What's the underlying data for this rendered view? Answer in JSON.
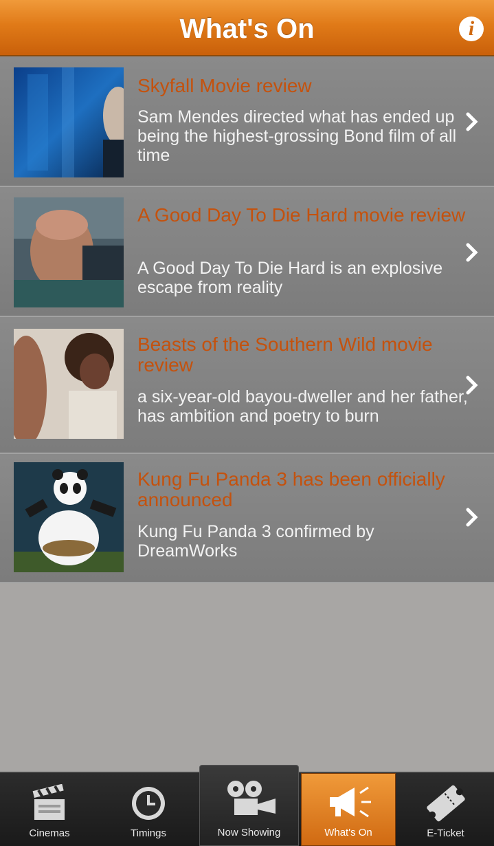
{
  "header": {
    "title": "What's On",
    "info_icon": "info-icon",
    "info_label": "i",
    "color": "#e07a18"
  },
  "articles": [
    {
      "title": "Skyfall Movie review",
      "description": "Sam Mendes directed what has ended up being the highest-grossing Bond film of all time",
      "thumbnail": "skyfall-still"
    },
    {
      "title": "A Good Day To Die Hard movie review",
      "description": "A Good Day To Die Hard is an explosive escape from reality",
      "thumbnail": "die-hard-still"
    },
    {
      "title": "Beasts of the Southern Wild movie review",
      "description": "a six-year-old bayou-dweller and her father, has ambition and poetry to burn",
      "thumbnail": "beasts-still"
    },
    {
      "title": "Kung Fu Panda 3 has been officially announced",
      "description": "Kung Fu Panda 3  confirmed by DreamWorks",
      "thumbnail": "panda-still"
    }
  ],
  "tabs": [
    {
      "label": "Cinemas",
      "icon": "clapperboard-icon"
    },
    {
      "label": "Timings",
      "icon": "clock-icon"
    },
    {
      "label": "Now Showing",
      "icon": "projector-icon"
    },
    {
      "label": "What's On",
      "icon": "megaphone-icon",
      "active": true
    },
    {
      "label": "E-Ticket",
      "icon": "ticket-icon"
    }
  ],
  "colors": {
    "accent": "#e07a18",
    "title_text": "#c4520e",
    "row_bg": "#858585",
    "page_bg": "#a8a6a4"
  }
}
